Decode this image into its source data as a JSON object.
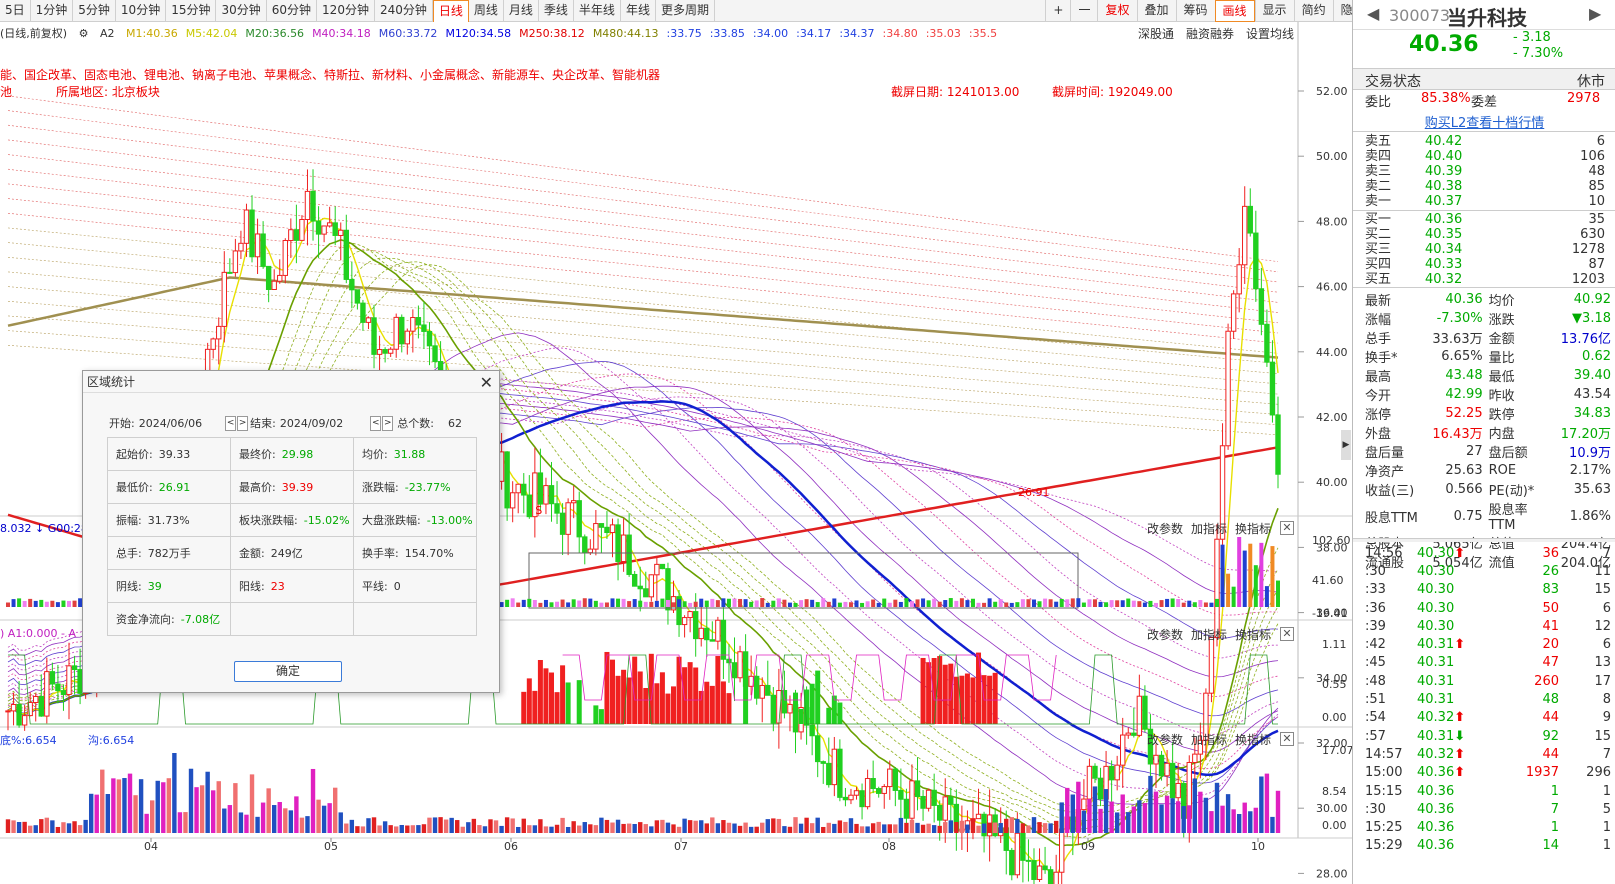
{
  "toolbar": {
    "periods": [
      {
        "label": "5日",
        "active": false
      },
      {
        "label": "1分钟",
        "active": false
      },
      {
        "label": "5分钟",
        "active": false
      },
      {
        "label": "10分钟",
        "active": false
      },
      {
        "label": "15分钟",
        "active": false
      },
      {
        "label": "30分钟",
        "active": false
      },
      {
        "label": "60分钟",
        "active": false
      },
      {
        "label": "120分钟",
        "active": false
      },
      {
        "label": "240分钟",
        "active": false
      },
      {
        "label": "日线",
        "active": true
      },
      {
        "label": "周线",
        "active": false
      },
      {
        "label": "月线",
        "active": false
      },
      {
        "label": "季线",
        "active": false
      },
      {
        "label": "半年线",
        "active": false
      },
      {
        "label": "年线",
        "active": false
      },
      {
        "label": "更多周期",
        "active": false
      }
    ],
    "plus": "+",
    "minus": "一",
    "tools": [
      "复权",
      "叠加",
      "筹码",
      "画线",
      "显示",
      "简约",
      "隐藏"
    ]
  },
  "chart_header": {
    "mode": "(日线,前复权)",
    "a2": "A2",
    "ma_labels": [
      {
        "text": "M1:40.36",
        "color": "#c8a800"
      },
      {
        "text": "M5:42.04",
        "color": "#c8c800"
      },
      {
        "text": "M20:36.56",
        "color": "#2c8a2c"
      },
      {
        "text": "M40:34.18",
        "color": "#c020c0"
      },
      {
        "text": "M60:33.72",
        "color": "#3040d0"
      },
      {
        "text": "M120:34.58",
        "color": "#0000e0"
      },
      {
        "text": "M250:38.12",
        "color": "#e00000"
      },
      {
        "text": "M480:44.13",
        "color": "#808000"
      },
      {
        "text": ":33.75",
        "color": "#2040e0"
      },
      {
        "text": ":33.85",
        "color": "#2040e0"
      },
      {
        "text": ":34.00",
        "color": "#2040e0"
      },
      {
        "text": ":34.17",
        "color": "#2040e0"
      },
      {
        "text": ":34.37",
        "color": "#2040e0"
      },
      {
        "text": ":34.80",
        "color": "#f04040"
      },
      {
        "text": ":35.03",
        "color": "#f04040"
      },
      {
        "text": ":35.5",
        "color": "#f04040"
      }
    ],
    "buttons": [
      "深股通",
      "融资融券",
      "设置均线"
    ]
  },
  "concepts": {
    "line1": "能、国企改革、固态电池、锂电池、钠离子电池、苹果概念、特斯拉、新材料、小金属概念、新能源车、央企改革、智能机器",
    "line2": "池",
    "region_label": "所属地区: 北京板块",
    "date_label": "截屏日期: 1241013.00",
    "time_label": "截屏时间: 192049.00"
  },
  "price_axis": [
    "52.00",
    "50.00",
    "48.00",
    "46.00",
    "44.00",
    "42.00",
    "40.00",
    "38.00",
    "36.00",
    "34.00",
    "32.00",
    "30.00",
    "28.00"
  ],
  "annotations": {
    "low_price": "26.91",
    "s_mark": "$"
  },
  "vol_panel": {
    "axis": [
      "102.60",
      "41.60",
      "-19.41"
    ],
    "left_label": "8.032 ↓ G00:28",
    "buttons": [
      "改参数",
      "加指标",
      "换指标"
    ]
  },
  "ind2": {
    "label": ") A1:0.000 - A",
    "axis": [
      "1.11",
      "0.55",
      "0.00"
    ],
    "buttons": [
      "改参数",
      "加指标",
      "换指标"
    ]
  },
  "ind3": {
    "label1": "底%:6.654",
    "label2": "沟:6.654",
    "axis": [
      "17.07",
      "8.54",
      "0.00"
    ],
    "buttons": [
      "改参数",
      "加指标",
      "换指标"
    ]
  },
  "months": [
    "04",
    "05",
    "06",
    "07",
    "08",
    "09",
    "10"
  ],
  "dialog": {
    "title": "区域统计",
    "start_label": "开始:",
    "start_date": "2024/06/06",
    "end_label": "结束:",
    "end_date": "2024/09/02",
    "count_label": "总个数:",
    "count": "62",
    "rows": [
      [
        {
          "k": "起始价:",
          "v": "39.33",
          "c": "#333"
        },
        {
          "k": "最终价:",
          "v": "29.98",
          "c": "#0a0"
        },
        {
          "k": "均价:",
          "v": "31.88",
          "c": "#0a0"
        }
      ],
      [
        {
          "k": "最低价:",
          "v": "26.91",
          "c": "#0a0"
        },
        {
          "k": "最高价:",
          "v": "39.39",
          "c": "#e00"
        },
        {
          "k": "涨跌幅:",
          "v": "-23.77%",
          "c": "#0a0"
        }
      ],
      [
        {
          "k": "振幅:",
          "v": "31.73%",
          "c": "#333"
        },
        {
          "k": "板块涨跌幅:",
          "v": "-15.02%",
          "c": "#0a0"
        },
        {
          "k": "大盘涨跌幅:",
          "v": "-13.00%",
          "c": "#0a0"
        }
      ],
      [
        {
          "k": "总手:",
          "v": "782万手",
          "c": "#333"
        },
        {
          "k": "金额:",
          "v": "249亿",
          "c": "#333"
        },
        {
          "k": "换手率:",
          "v": "154.70%",
          "c": "#333"
        }
      ],
      [
        {
          "k": "阴线:",
          "v": "39",
          "c": "#0a0"
        },
        {
          "k": "阳线:",
          "v": "23",
          "c": "#e00"
        },
        {
          "k": "平线:",
          "v": "0",
          "c": "#333"
        }
      ],
      [
        {
          "k": "资金净流向:",
          "v": "-7.08亿",
          "c": "#0a0"
        },
        {
          "k": "",
          "v": "",
          "c": "#333"
        },
        {
          "k": "",
          "v": "",
          "c": "#333"
        }
      ]
    ],
    "ok": "确定"
  },
  "stock": {
    "code": "300073",
    "name": "当升科技",
    "price": "40.36",
    "change": "- 3.18",
    "pct": "- 7.30%",
    "status_label": "交易状态",
    "status": "休市",
    "weibi_label": "委比",
    "weibi": "85.38%",
    "weicha_label": "委差",
    "weicha": "2978",
    "l2_link": "购买L2查看十档行情"
  },
  "order_book": {
    "asks": [
      {
        "label": "卖五",
        "price": "40.42",
        "vol": "6"
      },
      {
        "label": "卖四",
        "price": "40.40",
        "vol": "106"
      },
      {
        "label": "卖三",
        "price": "40.39",
        "vol": "48"
      },
      {
        "label": "卖二",
        "price": "40.38",
        "vol": "85"
      },
      {
        "label": "卖一",
        "price": "40.37",
        "vol": "10"
      }
    ],
    "bids": [
      {
        "label": "买一",
        "price": "40.36",
        "vol": "35"
      },
      {
        "label": "买二",
        "price": "40.35",
        "vol": "630"
      },
      {
        "label": "买三",
        "price": "40.34",
        "vol": "1278"
      },
      {
        "label": "买四",
        "price": "40.33",
        "vol": "87"
      },
      {
        "label": "买五",
        "price": "40.32",
        "vol": "1203"
      }
    ]
  },
  "quote": [
    [
      {
        "k": "最新",
        "v": "40.36",
        "c": "g"
      },
      {
        "k": "均价",
        "v": "40.92",
        "c": "g"
      }
    ],
    [
      {
        "k": "涨幅",
        "v": "-7.30%",
        "c": "g"
      },
      {
        "k": "涨跌",
        "v": "▼3.18",
        "c": "g"
      }
    ],
    [
      {
        "k": "总手",
        "v": "33.63万",
        "c": ""
      },
      {
        "k": "金额",
        "v": "13.76亿",
        "c": "b"
      }
    ],
    [
      {
        "k": "换手*",
        "v": "6.65%",
        "c": ""
      },
      {
        "k": "量比",
        "v": "0.62",
        "c": "g"
      }
    ],
    [
      {
        "k": "最高",
        "v": "43.48",
        "c": "g"
      },
      {
        "k": "最低",
        "v": "39.40",
        "c": "g"
      }
    ],
    [
      {
        "k": "今开",
        "v": "42.99",
        "c": "g"
      },
      {
        "k": "昨收",
        "v": "43.54",
        "c": ""
      }
    ],
    [
      {
        "k": "涨停",
        "v": "52.25",
        "c": "r"
      },
      {
        "k": "跌停",
        "v": "34.83",
        "c": "g"
      }
    ],
    [
      {
        "k": "外盘",
        "v": "16.43万",
        "c": "r"
      },
      {
        "k": "内盘",
        "v": "17.20万",
        "c": "g"
      }
    ],
    [
      {
        "k": "盘后量",
        "v": "27",
        "c": ""
      },
      {
        "k": "盘后额",
        "v": "10.9万",
        "c": "b"
      }
    ],
    [
      {
        "k": "净资产",
        "v": "25.63",
        "c": ""
      },
      {
        "k": "ROE",
        "v": "2.17%",
        "c": ""
      }
    ],
    [
      {
        "k": "收益(三)",
        "v": "0.566",
        "c": ""
      },
      {
        "k": "PE(动)*",
        "v": "35.63",
        "c": ""
      }
    ],
    [
      {
        "k": "股息TTM",
        "v": "0.75",
        "c": ""
      },
      {
        "k": "股息率TTM",
        "v": "1.86%",
        "c": ""
      }
    ],
    [
      {
        "k": "总股本",
        "v": "5.065亿",
        "c": ""
      },
      {
        "k": "总值",
        "v": "204.4亿",
        "c": ""
      }
    ],
    [
      {
        "k": "流通股",
        "v": "5.054亿",
        "c": ""
      },
      {
        "k": "流值",
        "v": "204.0亿",
        "c": ""
      }
    ]
  ],
  "trades": [
    {
      "t": "14:56",
      "p": "40.30",
      "a": "up",
      "v": "36",
      "vc": "r",
      "n": "7"
    },
    {
      "t": ":30",
      "p": "40.30",
      "a": "",
      "v": "26",
      "vc": "g",
      "n": "11"
    },
    {
      "t": ":33",
      "p": "40.30",
      "a": "",
      "v": "83",
      "vc": "g",
      "n": "15"
    },
    {
      "t": ":36",
      "p": "40.30",
      "a": "",
      "v": "50",
      "vc": "r",
      "n": "6"
    },
    {
      "t": ":39",
      "p": "40.30",
      "a": "",
      "v": "41",
      "vc": "r",
      "n": "12"
    },
    {
      "t": ":42",
      "p": "40.31",
      "a": "up",
      "v": "20",
      "vc": "r",
      "n": "6"
    },
    {
      "t": ":45",
      "p": "40.31",
      "a": "",
      "v": "47",
      "vc": "r",
      "n": "13"
    },
    {
      "t": ":48",
      "p": "40.31",
      "a": "",
      "v": "260",
      "vc": "r",
      "n": "17"
    },
    {
      "t": ":51",
      "p": "40.31",
      "a": "",
      "v": "48",
      "vc": "g",
      "n": "8"
    },
    {
      "t": ":54",
      "p": "40.32",
      "a": "up",
      "v": "44",
      "vc": "r",
      "n": "9"
    },
    {
      "t": ":57",
      "p": "40.31",
      "a": "down",
      "v": "92",
      "vc": "g",
      "n": "15"
    },
    {
      "t": "14:57",
      "p": "40.32",
      "a": "up",
      "v": "44",
      "vc": "r",
      "n": "7"
    },
    {
      "t": "15:00",
      "p": "40.36",
      "a": "up",
      "v": "1937",
      "vc": "r",
      "n": "296"
    },
    {
      "t": "15:15",
      "p": "40.36",
      "a": "",
      "v": "1",
      "vc": "g",
      "n": "1"
    },
    {
      "t": ":30",
      "p": "40.36",
      "a": "",
      "v": "7",
      "vc": "g",
      "n": "5"
    },
    {
      "t": "15:25",
      "p": "40.36",
      "a": "",
      "v": "1",
      "vc": "g",
      "n": "1"
    },
    {
      "t": "15:29",
      "p": "40.36",
      "a": "",
      "v": "14",
      "vc": "g",
      "n": "1"
    }
  ]
}
